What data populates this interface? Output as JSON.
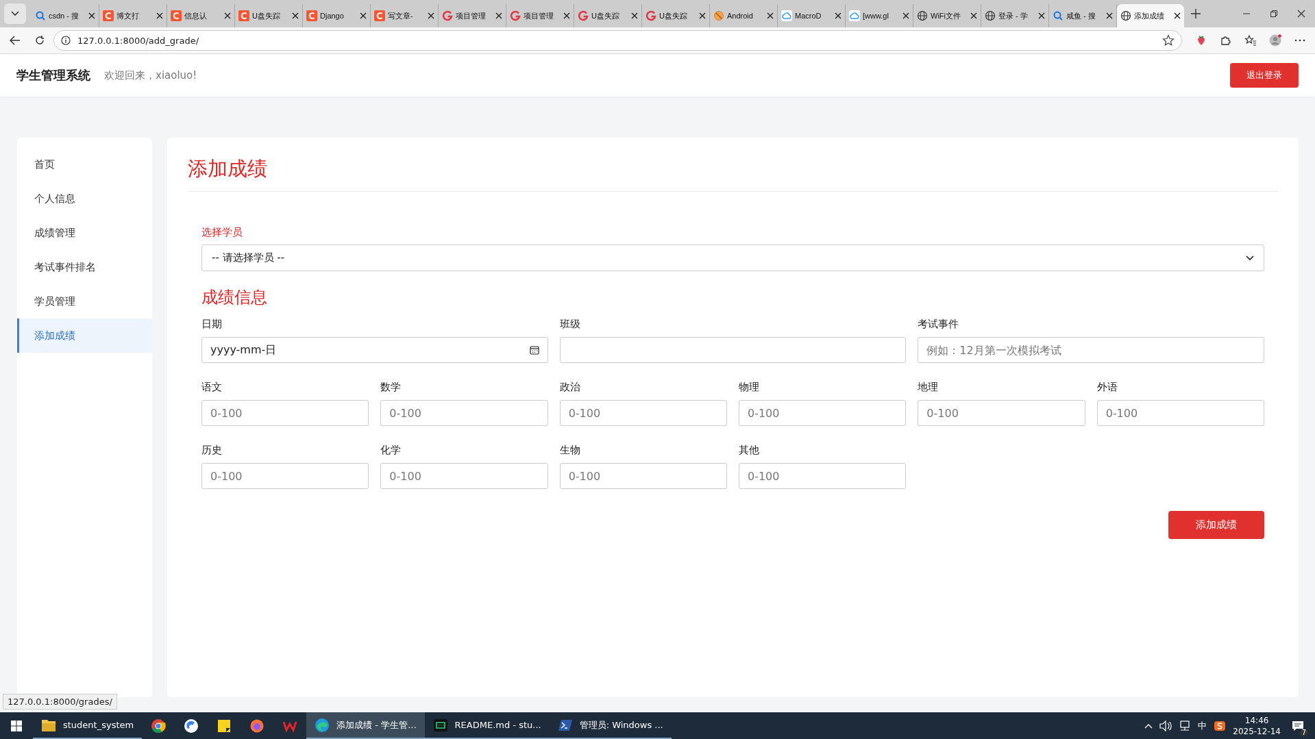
{
  "browser": {
    "tabs": [
      {
        "title": "csdn - 搜",
        "kind": "search",
        "selected": false
      },
      {
        "title": "博文打",
        "kind": "csdn",
        "selected": false
      },
      {
        "title": "信息认",
        "kind": "csdn",
        "selected": false
      },
      {
        "title": "U盘失踪",
        "kind": "csdn",
        "selected": false
      },
      {
        "title": "Django",
        "kind": "csdn",
        "selected": false
      },
      {
        "title": "写文章-",
        "kind": "csdn",
        "selected": false
      },
      {
        "title": "项目管理",
        "kind": "g",
        "selected": false
      },
      {
        "title": "项目管理",
        "kind": "g",
        "selected": false
      },
      {
        "title": "U盘失踪",
        "kind": "g",
        "selected": false
      },
      {
        "title": "U盘失踪",
        "kind": "g",
        "selected": false
      },
      {
        "title": "Android",
        "kind": "ban",
        "selected": false
      },
      {
        "title": "MacroD",
        "kind": "cloud",
        "selected": false
      },
      {
        "title": "[www.gl",
        "kind": "cloud",
        "selected": false
      },
      {
        "title": "WiFi文件",
        "kind": "globe",
        "selected": false
      },
      {
        "title": "登录 - 学",
        "kind": "globe",
        "selected": false
      },
      {
        "title": "咸鱼 - 搜",
        "kind": "search",
        "selected": false
      },
      {
        "title": "添加成绩",
        "kind": "globe",
        "selected": true
      }
    ],
    "address": "127.0.0.1:8000/add_grade/",
    "status_url": "127.0.0.1:8000/grades/"
  },
  "header": {
    "brand": "学生管理系统",
    "welcome": "欢迎回来，xiaoluo!",
    "logout": "退出登录"
  },
  "sidebar": {
    "items": [
      {
        "label": "首页",
        "selected": false
      },
      {
        "label": "个人信息",
        "selected": false
      },
      {
        "label": "成绩管理",
        "selected": false
      },
      {
        "label": "考试事件排名",
        "selected": false
      },
      {
        "label": "学员管理",
        "selected": false
      },
      {
        "label": "添加成绩",
        "selected": true
      }
    ]
  },
  "form": {
    "title": "添加成绩",
    "student_select": {
      "label": "选择学员",
      "value": "-- 请选择学员 --"
    },
    "section_title": "成绩信息",
    "fields": [
      {
        "kind": "date",
        "label": "日期",
        "value": "yyyy-mm-日"
      },
      {
        "kind": "text",
        "label": "班级"
      },
      {
        "kind": "text",
        "label": "考试事件",
        "placeholder": "例如：12月第一次模拟考试"
      },
      {
        "kind": "score",
        "label": "语文",
        "placeholder": "0-100"
      },
      {
        "kind": "score",
        "label": "数学",
        "placeholder": "0-100"
      },
      {
        "kind": "score",
        "label": "政治",
        "placeholder": "0-100"
      },
      {
        "kind": "score",
        "label": "物理",
        "placeholder": "0-100"
      },
      {
        "kind": "score",
        "label": "地理",
        "placeholder": "0-100"
      },
      {
        "kind": "score",
        "label": "外语",
        "placeholder": "0-100"
      },
      {
        "kind": "score",
        "label": "历史",
        "placeholder": "0-100"
      },
      {
        "kind": "score",
        "label": "化学",
        "placeholder": "0-100"
      },
      {
        "kind": "score",
        "label": "生物",
        "placeholder": "0-100"
      },
      {
        "kind": "score",
        "label": "其他",
        "placeholder": "0-100"
      }
    ],
    "submit": "添加成绩"
  },
  "taskbar": {
    "items": [
      {
        "kind": "folder",
        "label": "student_system",
        "selected": false
      },
      {
        "kind": "chrome",
        "selected": false
      },
      {
        "kind": "bluecircle",
        "selected": false
      },
      {
        "kind": "note",
        "selected": false
      },
      {
        "kind": "firefox",
        "selected": false
      },
      {
        "kind": "wps",
        "selected": false
      },
      {
        "kind": "edge",
        "label": "添加成绩 - 学生管...",
        "selected": true
      },
      {
        "kind": "terminal",
        "label": "README.md - stu...",
        "selected": false
      },
      {
        "kind": "powershell",
        "label": "管理员: Windows ...",
        "selected": false
      }
    ],
    "ime": "中",
    "time": "14:46",
    "date": "2025-12-14",
    "notifications": "7"
  }
}
